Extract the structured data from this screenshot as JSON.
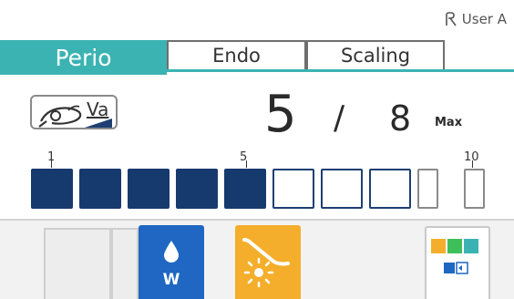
{
  "user": {
    "label": "User A",
    "icon": "user-icon"
  },
  "tabs": [
    {
      "label": "Perio",
      "active": true
    },
    {
      "label": "Endo",
      "active": false
    },
    {
      "label": "Scaling",
      "active": false
    }
  ],
  "vacuum": {
    "label": "Va",
    "icon": "handpiece-icon"
  },
  "level": {
    "current": "5",
    "separator": "/",
    "max": "8",
    "max_label": "Max"
  },
  "scale": {
    "ticks": [
      "1",
      "5",
      "10"
    ],
    "filled": 5,
    "total": 10
  },
  "bottom_buttons": [
    {
      "name": "water",
      "label": "W",
      "icon": "water-drop-icon",
      "color": "#1f67c2"
    },
    {
      "name": "light",
      "icon": "light-icon",
      "color": "#f4ae2b"
    },
    {
      "name": "palette",
      "icon": "color-palette-icon"
    }
  ],
  "colors": {
    "accent": "#3bb3b2",
    "level_fill": "#163a6e"
  }
}
